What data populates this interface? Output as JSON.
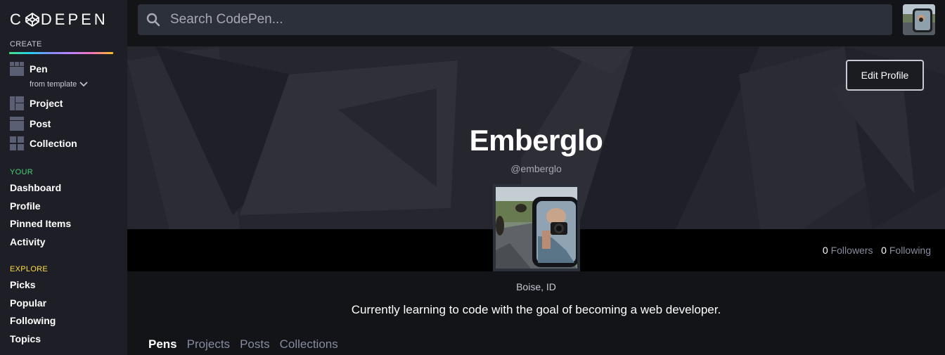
{
  "sidebar": {
    "logo_text_left": "C",
    "logo_text_right": "DEPEN",
    "create_label": "CREATE",
    "create_items": [
      {
        "label": "Pen",
        "icon": "pen-grid-icon"
      },
      {
        "label": "Project",
        "icon": "project-grid-icon"
      },
      {
        "label": "Post",
        "icon": "post-grid-icon"
      },
      {
        "label": "Collection",
        "icon": "collection-grid-icon"
      }
    ],
    "from_template": "from template",
    "your_label": "YOUR",
    "your_items": [
      "Dashboard",
      "Profile",
      "Pinned Items",
      "Activity"
    ],
    "explore_label": "EXPLORE",
    "explore_items": [
      "Picks",
      "Popular",
      "Following",
      "Topics"
    ]
  },
  "colors": {
    "your_label": "#47cf73",
    "explore_label": "#ffdd40"
  },
  "search": {
    "placeholder": "Search CodePen..."
  },
  "profile": {
    "edit_button": "Edit Profile",
    "name": "Emberglo",
    "handle": "@emberglo",
    "followers_count": "0",
    "followers_label": "Followers",
    "following_count": "0",
    "following_label": "Following",
    "location": "Boise, ID",
    "bio": "Currently learning to code with the goal of becoming a web developer."
  },
  "tabs": [
    "Pens",
    "Projects",
    "Posts",
    "Collections"
  ]
}
